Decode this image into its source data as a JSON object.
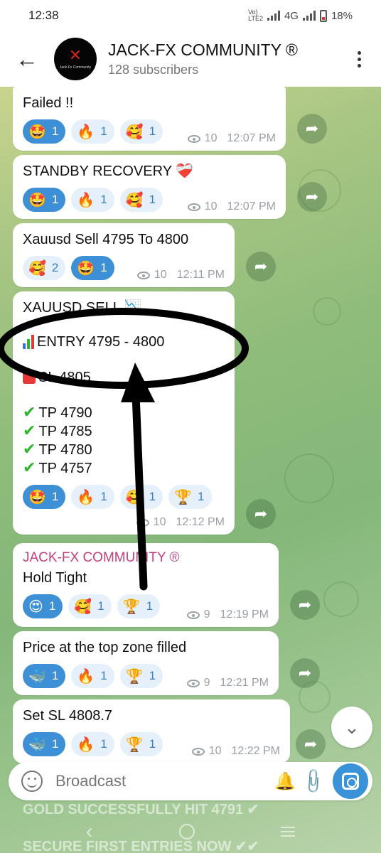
{
  "status": {
    "time": "12:38",
    "network": "4G",
    "carrier_badge": "Vo))\nLTE2",
    "battery": "18%"
  },
  "header": {
    "title": "JACK-FX COMMUNITY ®",
    "subscribers": "128 subscribers",
    "avatar_text": "Jack-Fx Community"
  },
  "messages": [
    {
      "text": "Failed !!",
      "reactions": [
        {
          "emoji": "🤩",
          "count": "1"
        },
        {
          "emoji": "🔥",
          "count": "1"
        },
        {
          "emoji": "🥰",
          "count": "1"
        }
      ],
      "views": "10",
      "time": "12:07 PM"
    },
    {
      "text": "STANDBY RECOVERY ❤️‍🩹",
      "reactions": [
        {
          "emoji": "🤩",
          "count": "1"
        },
        {
          "emoji": "🔥",
          "count": "1"
        },
        {
          "emoji": "🥰",
          "count": "1"
        }
      ],
      "views": "10",
      "time": "12:07 PM"
    },
    {
      "text": "Xauusd Sell 4795 To 4800",
      "reactions": [
        {
          "emoji": "🥰",
          "count": "2"
        },
        {
          "emoji": "🤩",
          "count": "1"
        }
      ],
      "views": "10",
      "time": "12:11 PM"
    },
    {
      "title": "XAUUSD SELL 📉",
      "entry": "ENTRY 4795 - 4800",
      "sl": "SL 4805",
      "tps": [
        "TP 4790",
        "TP 4785",
        "TP 4780",
        "TP 4757"
      ],
      "reactions": [
        {
          "emoji": "🤩",
          "count": "1"
        },
        {
          "emoji": "🔥",
          "count": "1"
        },
        {
          "emoji": "🥰",
          "count": "1"
        },
        {
          "emoji": "🏆",
          "count": "1"
        }
      ],
      "views": "10",
      "time": "12:12 PM"
    },
    {
      "author": "JACK-FX COMMUNITY ®",
      "text": "Hold Tight",
      "reactions": [
        {
          "emoji": "😍",
          "count": "1"
        },
        {
          "emoji": "🥰",
          "count": "1"
        },
        {
          "emoji": "🏆",
          "count": "1"
        }
      ],
      "views": "9",
      "time": "12:19 PM"
    },
    {
      "text": "Price at the top zone filled",
      "reactions": [
        {
          "emoji": "🐳",
          "count": "1"
        },
        {
          "emoji": "🔥",
          "count": "1"
        },
        {
          "emoji": "🏆",
          "count": "1"
        }
      ],
      "views": "9",
      "time": "12:21 PM"
    },
    {
      "text": "Set SL 4808.7",
      "reactions": [
        {
          "emoji": "🐳",
          "count": "1"
        },
        {
          "emoji": "🔥",
          "count": "1"
        },
        {
          "emoji": "🏆",
          "count": "1"
        }
      ],
      "views": "10",
      "time": "12:22 PM"
    }
  ],
  "composer": {
    "placeholder": "Broadcast"
  },
  "underlay": {
    "line1": "GOLD SUCCESSFULLY HIT 4791 ✔",
    "line2": "SECURE FIRST ENTRIES NOW ✔✔"
  },
  "colors": {
    "accent": "#3d8fd6",
    "author": "#c2417d",
    "annotation": "#000000"
  }
}
